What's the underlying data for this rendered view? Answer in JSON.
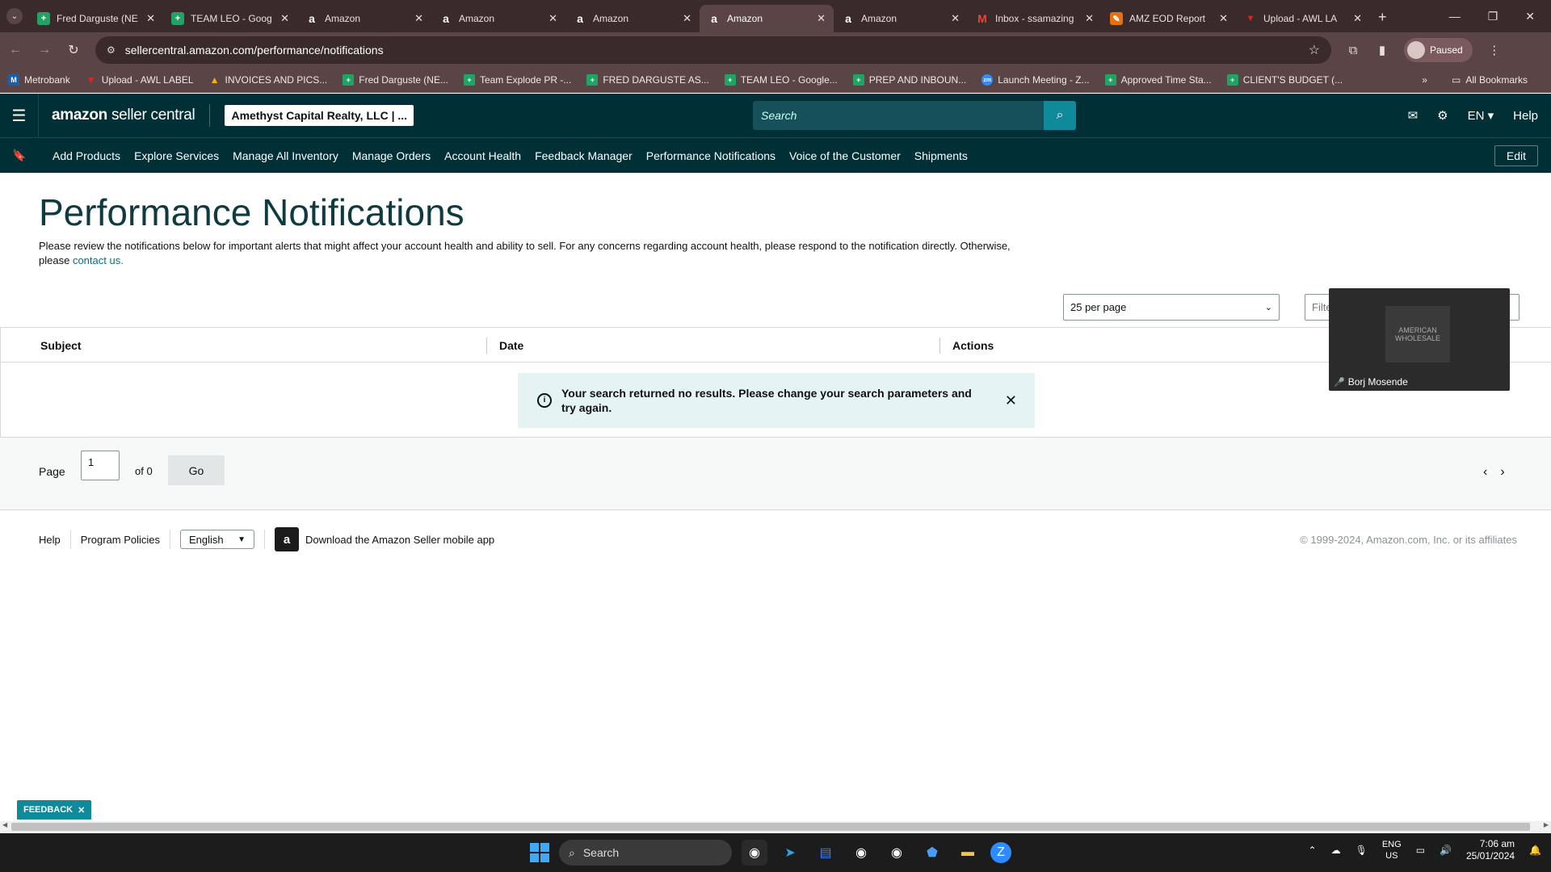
{
  "browser": {
    "tabs": [
      {
        "title": "Fred Darguste (NE",
        "icon": "sheets-icon"
      },
      {
        "title": "TEAM LEO - Goog",
        "icon": "sheets-icon"
      },
      {
        "title": "Amazon",
        "icon": "amazon-icon"
      },
      {
        "title": "Amazon",
        "icon": "amazon-icon"
      },
      {
        "title": "Amazon",
        "icon": "amazon-icon"
      },
      {
        "title": "Amazon",
        "icon": "amazon-icon",
        "active": true
      },
      {
        "title": "Amazon",
        "icon": "amazon-icon"
      },
      {
        "title": "Inbox - ssamazing",
        "icon": "gmail-icon"
      },
      {
        "title": "AMZ EOD Report",
        "icon": "report-icon"
      },
      {
        "title": "Upload - AWL LA",
        "icon": "pdf-icon"
      }
    ],
    "url": "sellercentral.amazon.com/performance/notifications",
    "profile_status": "Paused",
    "bookmarks": [
      {
        "label": "Metrobank",
        "icon": "bank-icon"
      },
      {
        "label": "Upload - AWL LABEL",
        "icon": "pdf-icon"
      },
      {
        "label": "INVOICES AND PICS...",
        "icon": "drive-icon"
      },
      {
        "label": "Fred Darguste (NE...",
        "icon": "sheets-icon"
      },
      {
        "label": "Team Explode PR -...",
        "icon": "sheets-icon"
      },
      {
        "label": "FRED DARGUSTE AS...",
        "icon": "sheets-icon"
      },
      {
        "label": "TEAM LEO - Google...",
        "icon": "sheets-icon"
      },
      {
        "label": "PREP AND INBOUN...",
        "icon": "sheets-icon"
      },
      {
        "label": "Launch Meeting - Z...",
        "icon": "zoom-icon"
      },
      {
        "label": "Approved Time Sta...",
        "icon": "sheets-icon"
      },
      {
        "label": "CLIENT'S BUDGET (...",
        "icon": "sheets-icon"
      }
    ],
    "all_bookmarks": "All Bookmarks"
  },
  "header": {
    "logo_main": "amazon",
    "logo_sub": "seller central",
    "account": "Amethyst Capital Realty, LLC | ...",
    "search_placeholder": "Search",
    "language": "EN",
    "help": "Help"
  },
  "nav": {
    "items": [
      "Add Products",
      "Explore Services",
      "Manage All Inventory",
      "Manage Orders",
      "Account Health",
      "Feedback Manager",
      "Performance Notifications",
      "Voice of the Customer",
      "Shipments"
    ],
    "edit": "Edit"
  },
  "main": {
    "title": "Performance Notifications",
    "intro": "Please review the notifications below for important alerts that might affect your account health and ability to sell. For any concerns regarding account health, please respond to the notification directly. Otherwise, please",
    "contact_link": "contact us.",
    "per_page": "25 per page",
    "filter_placeholder": "Filte",
    "columns": [
      "Subject",
      "Date",
      "Actions"
    ],
    "alert": "Your search returned no results. Please change your search parameters and try again.",
    "pager": {
      "label": "Page",
      "value": "1",
      "of": "of 0",
      "go": "Go"
    }
  },
  "footer": {
    "help": "Help",
    "policies": "Program Policies",
    "language": "English",
    "app_link": "Download the Amazon Seller mobile app",
    "copyright": "© 1999-2024, Amazon.com, Inc. or its affiliates"
  },
  "zoom": {
    "participant": "Borj Mosende",
    "logo_text": "AMERICAN WHOLESALE"
  },
  "feedback": "FEEDBACK",
  "taskbar": {
    "search": "Search",
    "lang_top": "ENG",
    "lang_bottom": "US",
    "time": "7:06 am",
    "date": "25/01/2024"
  }
}
